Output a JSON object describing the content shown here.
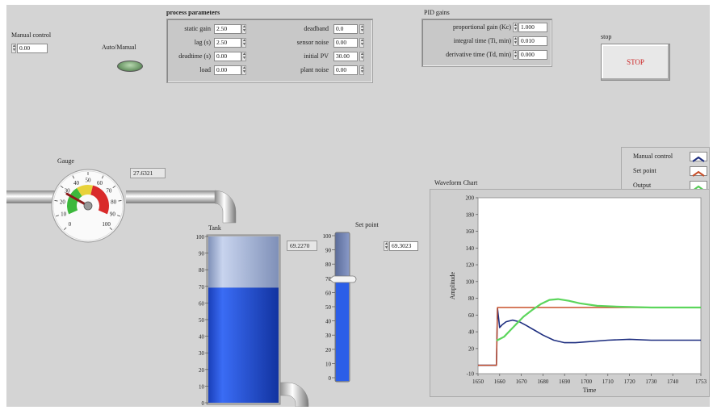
{
  "manual_control": {
    "label": "Manual control",
    "value": "0.00"
  },
  "auto_manual": {
    "label": "Auto/Manual"
  },
  "process_parameters": {
    "title": "process parameters",
    "left": [
      {
        "label": "static gain",
        "value": "2.50"
      },
      {
        "label": "lag (s)",
        "value": "2.50"
      },
      {
        "label": "deadtime (s)",
        "value": "0.00"
      },
      {
        "label": "load",
        "value": "0.00"
      }
    ],
    "right": [
      {
        "label": "deadband",
        "value": "0.0"
      },
      {
        "label": "sensor noise",
        "value": "0.00"
      },
      {
        "label": "initial PV",
        "value": "30.00"
      },
      {
        "label": "plant noise",
        "value": "0.00"
      }
    ]
  },
  "pid_gains": {
    "title": "PID gains",
    "items": [
      {
        "label": "proportional gain (Kc)",
        "value": "1.000"
      },
      {
        "label": "integral time (Ti, min)",
        "value": "0.010"
      },
      {
        "label": "derivative time (Td, min)",
        "value": "0.000"
      }
    ]
  },
  "stop": {
    "label": "stop",
    "button_text": "STOP"
  },
  "gauge": {
    "label": "Gauge",
    "readout": "27.6321",
    "value": 27.6321,
    "ticks": [
      "0",
      "10",
      "20",
      "30",
      "40",
      "50",
      "60",
      "70",
      "80",
      "90",
      "100"
    ]
  },
  "tank": {
    "label": "Tank",
    "readout": "69.2270",
    "level": 69.227,
    "ticks": [
      "100",
      "90",
      "80",
      "70",
      "60",
      "50",
      "40",
      "30",
      "20",
      "10",
      "0"
    ]
  },
  "set_point": {
    "label": "Set point",
    "value": "69.3023",
    "level": 69.3023,
    "ticks": [
      "100",
      "90",
      "80",
      "70",
      "60",
      "50",
      "40",
      "30",
      "20",
      "10",
      "0"
    ]
  },
  "legend": [
    {
      "name": "Manual control",
      "color": "#1f2f80"
    },
    {
      "name": "Set point",
      "color": "#c8502a"
    },
    {
      "name": "Output",
      "color": "#55cc55"
    }
  ],
  "colors": {
    "manual": "#1f2f80",
    "setpoint": "#c8502a",
    "output": "#5cd65c",
    "tank_fill": "#2b5ee8",
    "stop_text": "#cc2222"
  },
  "chart_data": {
    "type": "line",
    "title": "Waveform Chart",
    "xlabel": "Time",
    "ylabel": "Amplitude",
    "xlim": [
      1650,
      1753
    ],
    "ylim": [
      -10,
      200
    ],
    "xticks": [
      "1650",
      "1660",
      "1670",
      "1680",
      "1690",
      "1700",
      "1710",
      "1720",
      "1730",
      "1740",
      "1753"
    ],
    "yticks": [
      "200",
      "180",
      "160",
      "140",
      "120",
      "100",
      "80",
      "60",
      "40",
      "20",
      "-10"
    ],
    "series": [
      {
        "name": "Manual control",
        "x": [
          1650,
          1658.5,
          1659,
          1660,
          1661,
          1663,
          1666,
          1669,
          1672,
          1676,
          1680,
          1685,
          1690,
          1695,
          1700,
          1710,
          1720,
          1730,
          1740,
          1753
        ],
        "y": [
          0,
          0,
          68,
          45,
          48,
          52,
          54,
          52,
          48,
          42,
          36,
          30,
          27,
          27,
          28,
          30,
          31,
          30,
          30,
          30
        ]
      },
      {
        "name": "Set point",
        "x": [
          1650,
          1658.5,
          1659,
          1753
        ],
        "y": [
          0,
          0,
          69,
          69
        ]
      },
      {
        "name": "Output",
        "x": [
          1658.5,
          1659,
          1662,
          1665,
          1668,
          1671,
          1675,
          1679,
          1683,
          1687,
          1692,
          1697,
          1705,
          1715,
          1730,
          1753
        ],
        "y": [
          30,
          30,
          34,
          42,
          50,
          58,
          66,
          73,
          78,
          79,
          77,
          74,
          71,
          70,
          69,
          69
        ]
      }
    ]
  }
}
